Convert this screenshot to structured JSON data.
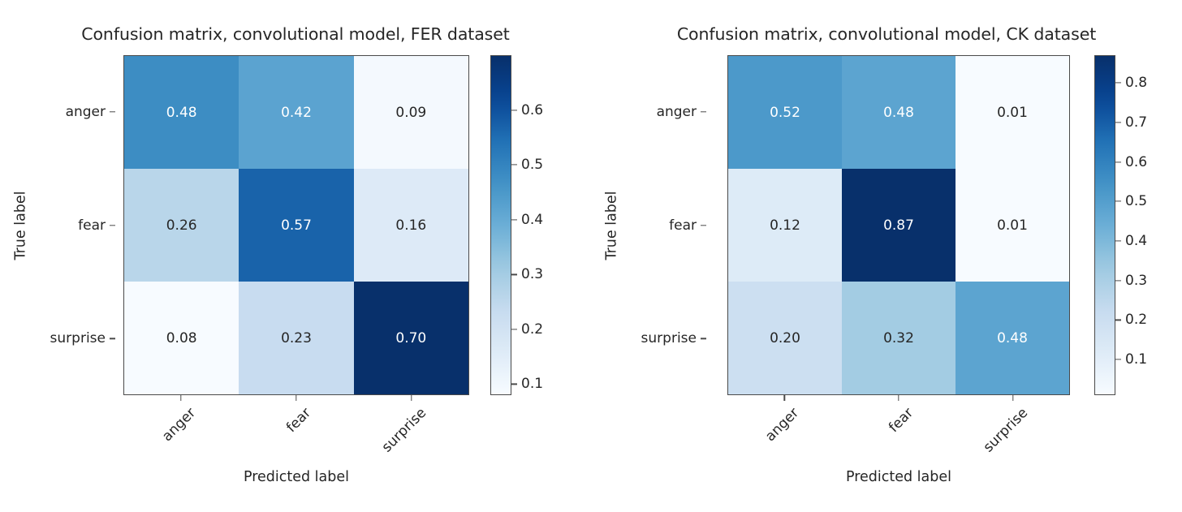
{
  "figure": {
    "background": "#ffffff",
    "colormap": "Blues",
    "panels": [
      {
        "id": "fer",
        "title": "Confusion matrix, convolutional model, FER dataset",
        "xlabel": "Predicted label",
        "ylabel": "True label",
        "row_labels": [
          "anger",
          "fear",
          "surprise"
        ],
        "col_labels": [
          "anger",
          "fear",
          "surprise"
        ],
        "matrix": [
          [
            0.48,
            0.42,
            0.09
          ],
          [
            0.26,
            0.57,
            0.16
          ],
          [
            0.08,
            0.23,
            0.7
          ]
        ],
        "cell_text": [
          [
            "0.48",
            "0.42",
            "0.09"
          ],
          [
            "0.26",
            "0.57",
            "0.16"
          ],
          [
            "0.08",
            "0.23",
            "0.70"
          ]
        ],
        "vmin": 0.08,
        "vmax": 0.7,
        "colorbar_ticks": [
          0.1,
          0.2,
          0.3,
          0.4,
          0.5,
          0.6
        ],
        "colorbar_tick_labels": [
          "0.1",
          "0.2",
          "0.3",
          "0.4",
          "0.5",
          "0.6"
        ]
      },
      {
        "id": "ck",
        "title": "Confusion matrix, convolutional model, CK dataset",
        "xlabel": "Predicted label",
        "ylabel": "True label",
        "row_labels": [
          "anger",
          "fear",
          "surprise"
        ],
        "col_labels": [
          "anger",
          "fear",
          "surprise"
        ],
        "matrix": [
          [
            0.52,
            0.48,
            0.01
          ],
          [
            0.12,
            0.87,
            0.01
          ],
          [
            0.2,
            0.32,
            0.48
          ]
        ],
        "cell_text": [
          [
            "0.52",
            "0.48",
            "0.01"
          ],
          [
            "0.12",
            "0.87",
            "0.01"
          ],
          [
            "0.20",
            "0.32",
            "0.48"
          ]
        ],
        "vmin": 0.01,
        "vmax": 0.87,
        "colorbar_ticks": [
          0.1,
          0.2,
          0.3,
          0.4,
          0.5,
          0.6,
          0.7,
          0.8
        ],
        "colorbar_tick_labels": [
          "0.1",
          "0.2",
          "0.3",
          "0.4",
          "0.5",
          "0.6",
          "0.7",
          "0.8"
        ]
      }
    ]
  },
  "chart_data": [
    {
      "type": "heatmap",
      "title": "Confusion matrix, convolutional model, FER dataset",
      "xlabel": "Predicted label",
      "ylabel": "True label",
      "x_tick_labels": [
        "anger",
        "fear",
        "surprise"
      ],
      "y_tick_labels": [
        "anger",
        "fear",
        "surprise"
      ],
      "values": [
        [
          0.48,
          0.42,
          0.09
        ],
        [
          0.26,
          0.57,
          0.16
        ],
        [
          0.08,
          0.23,
          0.7
        ]
      ],
      "annotations": [
        [
          "0.48",
          "0.42",
          "0.09"
        ],
        [
          "0.26",
          "0.57",
          "0.16"
        ],
        [
          "0.08",
          "0.23",
          "0.70"
        ]
      ],
      "colormap": "Blues",
      "clim": [
        0.08,
        0.7
      ],
      "colorbar": {
        "position": "right",
        "ticks": [
          0.1,
          0.2,
          0.3,
          0.4,
          0.5,
          0.6
        ]
      },
      "grid": false,
      "legend": "none"
    },
    {
      "type": "heatmap",
      "title": "Confusion matrix, convolutional model, CK dataset",
      "xlabel": "Predicted label",
      "ylabel": "True label",
      "x_tick_labels": [
        "anger",
        "fear",
        "surprise"
      ],
      "y_tick_labels": [
        "anger",
        "fear",
        "surprise"
      ],
      "values": [
        [
          0.52,
          0.48,
          0.01
        ],
        [
          0.12,
          0.87,
          0.01
        ],
        [
          0.2,
          0.32,
          0.48
        ]
      ],
      "annotations": [
        [
          "0.52",
          "0.48",
          "0.01"
        ],
        [
          "0.12",
          "0.87",
          "0.01"
        ],
        [
          "0.20",
          "0.32",
          "0.48"
        ]
      ],
      "colormap": "Blues",
      "clim": [
        0.01,
        0.87
      ],
      "colorbar": {
        "position": "right",
        "ticks": [
          0.1,
          0.2,
          0.3,
          0.4,
          0.5,
          0.6,
          0.7,
          0.8
        ]
      },
      "grid": false,
      "legend": "none"
    }
  ]
}
